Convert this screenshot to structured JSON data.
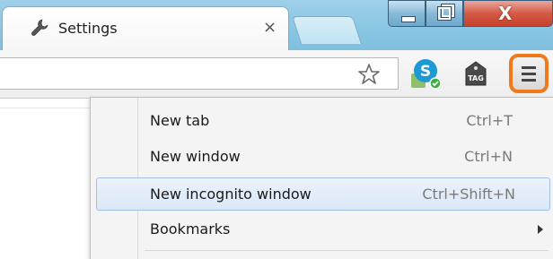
{
  "tab": {
    "title": "Settings",
    "close_glyph": "×",
    "icon": "wrench-icon"
  },
  "window_controls": {
    "close_glyph": "X"
  },
  "toolbar": {
    "bookmark_icon": "star-icon",
    "extensions": [
      "skype-extension-icon",
      "tag-extension-icon"
    ],
    "menu_icon": "hamburger-menu-icon",
    "menu_highlight_color": "#f07a1a"
  },
  "menu": {
    "items": [
      {
        "label": "New tab",
        "shortcut": "Ctrl+T"
      },
      {
        "label": "New window",
        "shortcut": "Ctrl+N"
      },
      {
        "label": "New incognito window",
        "shortcut": "Ctrl+Shift+N",
        "highlighted": true
      },
      {
        "label": "Bookmarks",
        "shortcut": "",
        "submenu": true
      }
    ]
  }
}
